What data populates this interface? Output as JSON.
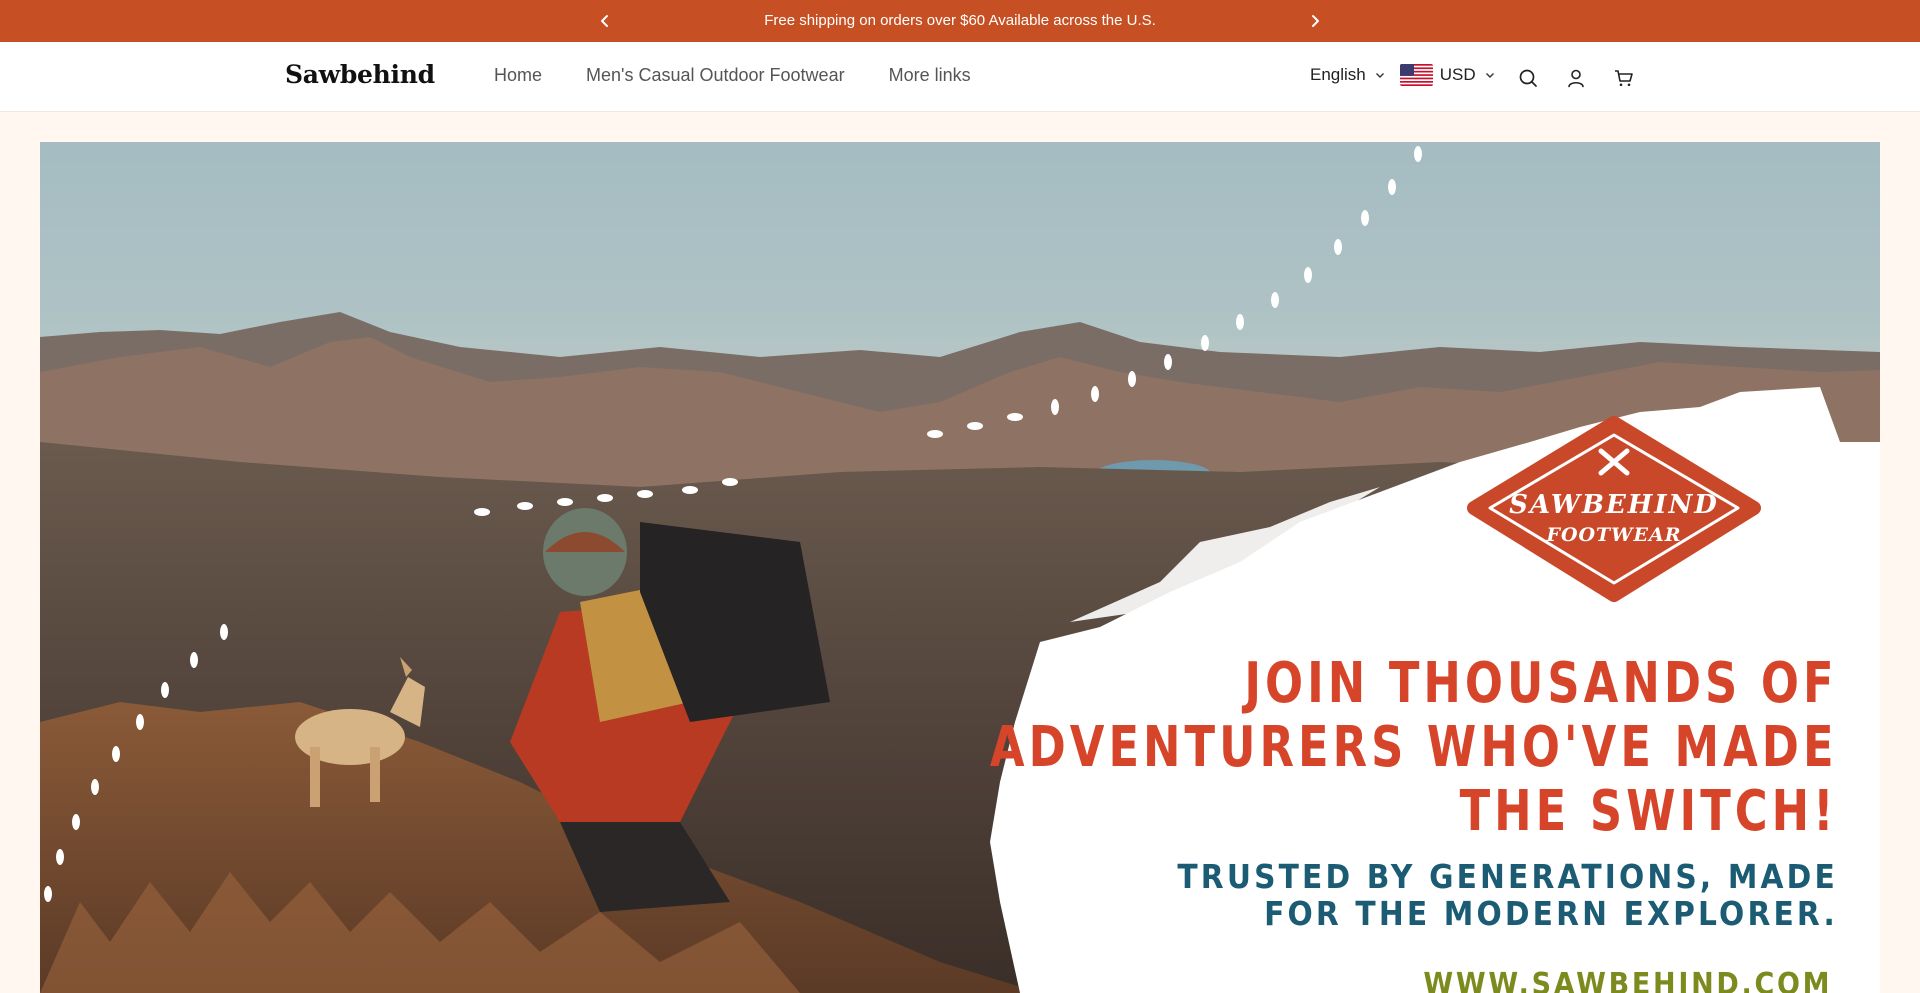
{
  "announcement": {
    "message": "Free shipping on orders over $60 Available across the U.S.",
    "prev_icon": "chevron-left-icon",
    "next_icon": "chevron-right-icon"
  },
  "header": {
    "logo": "Sawbehind",
    "nav": [
      {
        "label": "Home"
      },
      {
        "label": "Men's Casual Outdoor Footwear"
      },
      {
        "label": "More links"
      }
    ],
    "language": "English",
    "currency": "USD",
    "icons": [
      "search-icon",
      "account-icon",
      "cart-icon"
    ]
  },
  "hero": {
    "badge_line1": "SAWBEHIND",
    "badge_line2": "FOOTWEAR",
    "headline": [
      "JOIN THOUSANDS OF",
      "ADVENTURERS WHO'VE MADE",
      "THE SWITCH!"
    ],
    "subheadline": [
      "TRUSTED BY GENERATIONS, MADE",
      "FOR THE MODERN EXPLORER."
    ],
    "url": "WWW.SAWBEHIND.COM"
  },
  "colors": {
    "announcement_bg": "#c65023",
    "page_bg": "#fff7f0",
    "headline": "#d6452a",
    "subheadline": "#1c5b74",
    "url": "#7d8b1e"
  }
}
